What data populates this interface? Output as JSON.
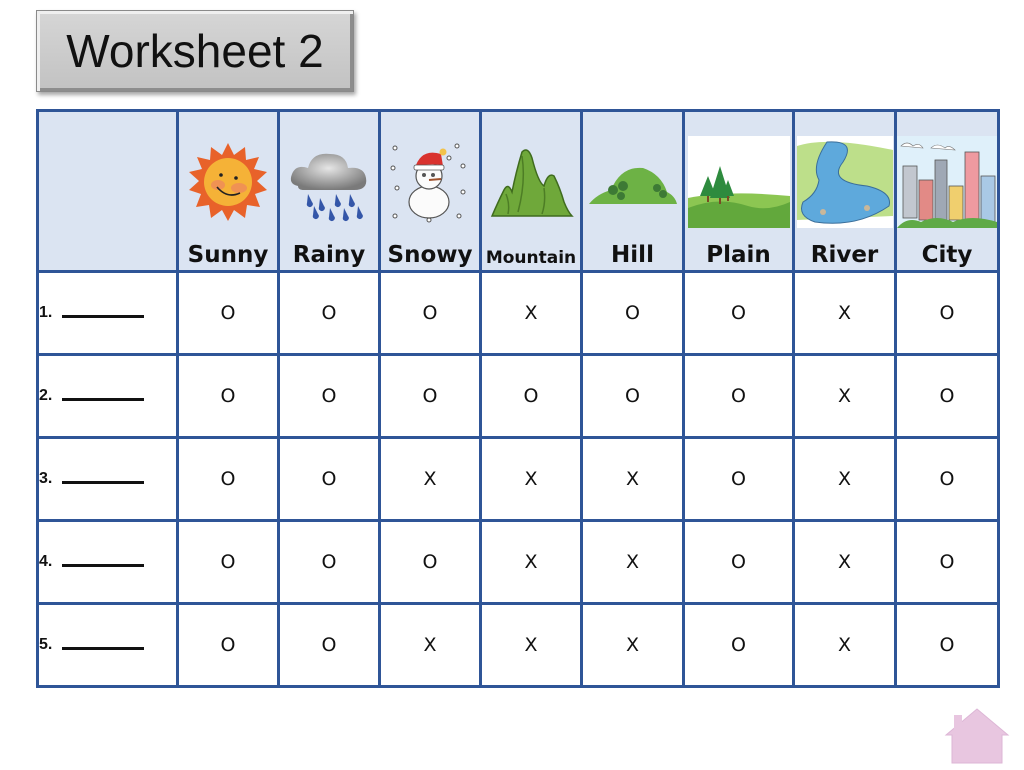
{
  "title": "Worksheet 2",
  "columns": [
    {
      "key": "sunny",
      "label": "Sunny",
      "icon": "sun-icon"
    },
    {
      "key": "rainy",
      "label": "Rainy",
      "icon": "rain-cloud-icon"
    },
    {
      "key": "snowy",
      "label": "Snowy",
      "icon": "snowman-icon"
    },
    {
      "key": "mountain",
      "label": "Mountain",
      "icon": "mountain-icon"
    },
    {
      "key": "hill",
      "label": "Hill",
      "icon": "hill-icon"
    },
    {
      "key": "plain",
      "label": "Plain",
      "icon": "plain-icon"
    },
    {
      "key": "river",
      "label": "River",
      "icon": "river-icon"
    },
    {
      "key": "city",
      "label": "City",
      "icon": "city-icon"
    }
  ],
  "rows": [
    {
      "number": "1.",
      "values": [
        "O",
        "O",
        "O",
        "X",
        "O",
        "O",
        "X",
        "O"
      ]
    },
    {
      "number": "2.",
      "values": [
        "O",
        "O",
        "O",
        "O",
        "O",
        "O",
        "X",
        "O"
      ]
    },
    {
      "number": "3.",
      "values": [
        "O",
        "O",
        "X",
        "X",
        "X",
        "O",
        "X",
        "O"
      ]
    },
    {
      "number": "4.",
      "values": [
        "O",
        "O",
        "O",
        "X",
        "X",
        "O",
        "X",
        "O"
      ]
    },
    {
      "number": "5.",
      "values": [
        "O",
        "O",
        "X",
        "X",
        "X",
        "O",
        "X",
        "O"
      ]
    }
  ],
  "home_button": {
    "icon": "home-icon"
  },
  "colors": {
    "grid_border": "#2f5597",
    "header_bg": "#dbe4f2",
    "home_pink": "#e8c6e0"
  }
}
